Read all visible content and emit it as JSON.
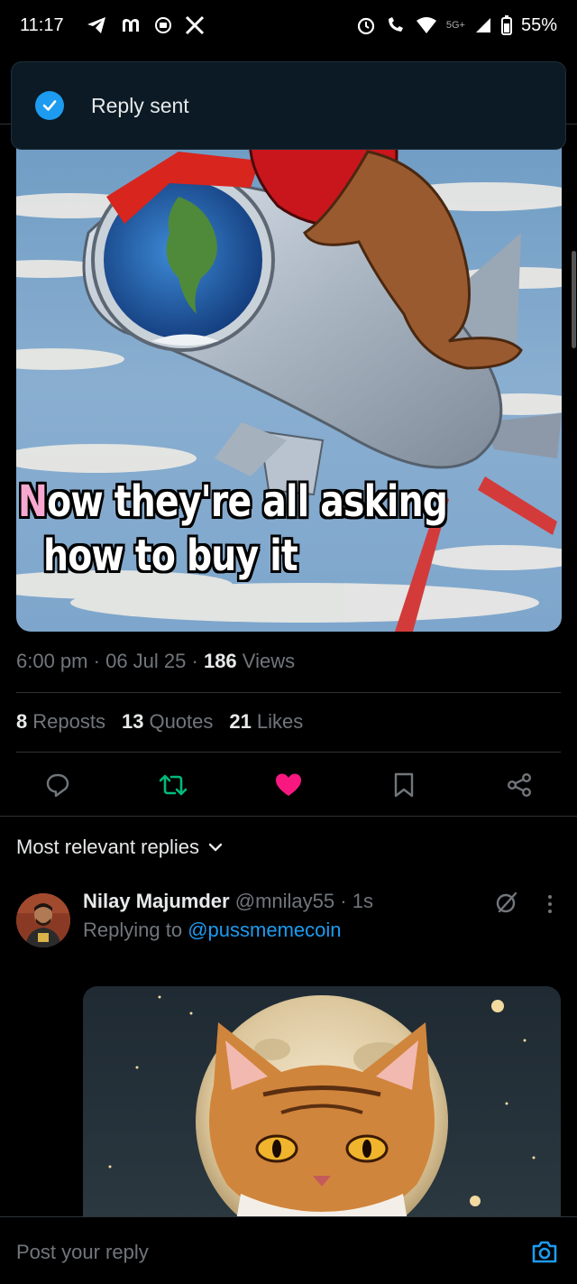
{
  "status_bar": {
    "time": "11:17",
    "network": "5G+",
    "battery": "55%"
  },
  "toast": {
    "message": "Reply sent"
  },
  "post": {
    "image_text_line1": "Now they're all asking",
    "image_text_line2": "how to buy it",
    "time": "6:00 pm",
    "date": "06 Jul 25",
    "views_count": "186",
    "views_label": "Views",
    "reposts_count": "8",
    "reposts_label": "Reposts",
    "quotes_count": "13",
    "quotes_label": "Quotes",
    "likes_count": "21",
    "likes_label": "Likes"
  },
  "actions": {
    "reply_icon": "comment-icon",
    "repost_icon": "repost-icon",
    "like_icon": "heart-icon",
    "bookmark_icon": "bookmark-icon",
    "share_icon": "share-icon",
    "repost_color": "#00ba7c",
    "like_color": "#f91880"
  },
  "replies": {
    "sort_label": "Most relevant replies",
    "items": [
      {
        "name": "Nilay Majumder",
        "handle": "@mnilay55",
        "time": "1s",
        "replying_prefix": "Replying to",
        "replying_to": "@pussmemecoin"
      }
    ]
  },
  "compose": {
    "placeholder": "Post your reply"
  },
  "colors": {
    "accent": "#1d9bf0",
    "background": "#000000",
    "muted": "#71767b"
  }
}
